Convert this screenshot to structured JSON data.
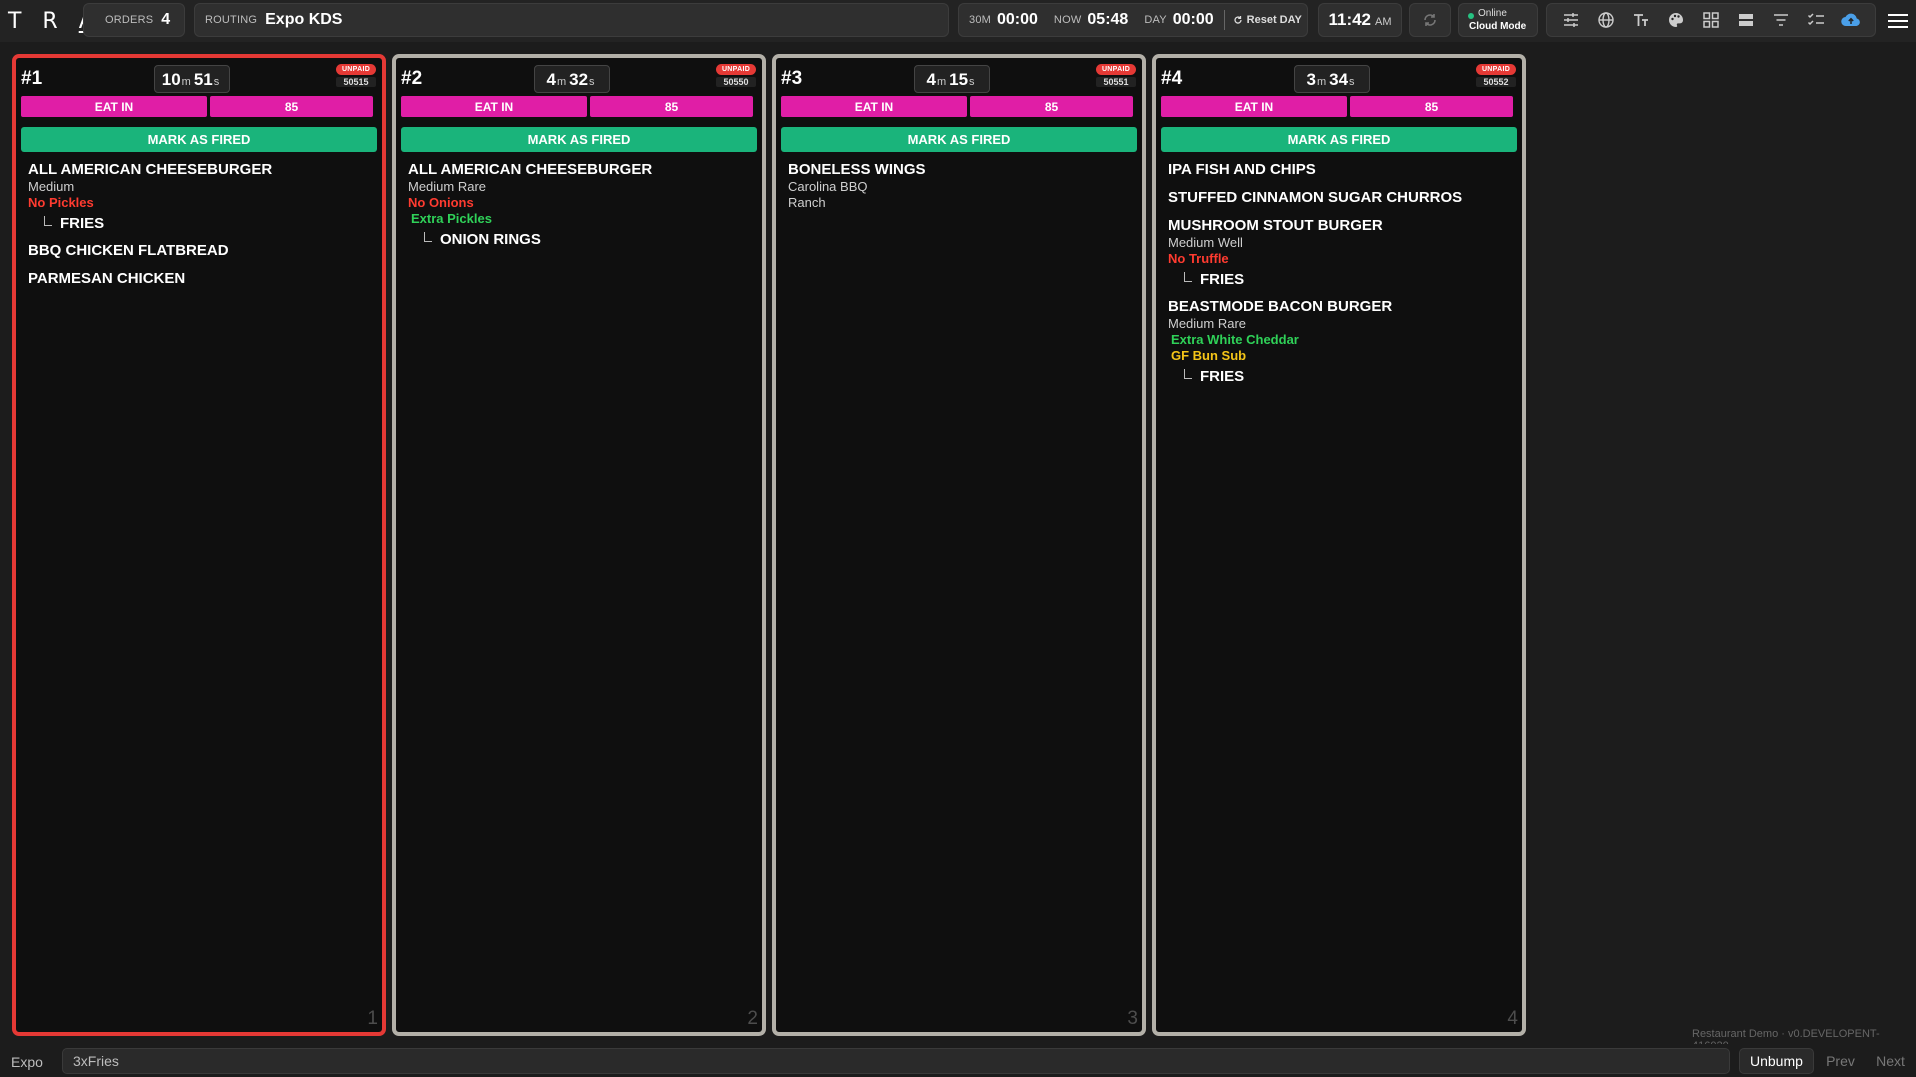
{
  "header": {
    "logo": "TRAY",
    "orders_label": "ORDERS",
    "orders_count": "4",
    "routing_label": "ROUTING",
    "routing_value": "Expo KDS",
    "t30_label": "30M",
    "t30_value": "00:00",
    "now_label": "NOW",
    "now_value": "05:48",
    "day_label": "DAY",
    "day_value": "00:00",
    "reset_label": "Reset DAY",
    "clock_time": "11:42",
    "clock_ampm": "AM",
    "status_line1": "Online",
    "status_line2": "Cloud Mode",
    "icons": [
      "refresh-icon",
      "sliders-icon",
      "globe-icon",
      "text-size-icon",
      "palette-icon",
      "grid-icon",
      "rows-icon",
      "filter-icon",
      "checklist-icon",
      "cloud-upload-icon",
      "hamburger-menu-icon"
    ],
    "colors": {
      "online_dot": "#26c281",
      "cloud": "#4a9fe8"
    }
  },
  "tickets": [
    {
      "num": "#1",
      "min": "10",
      "min_unit": "m",
      "sec": "51",
      "sec_unit": "s",
      "unpaid": "UNPAID",
      "order_id": "50515",
      "order_type": "EAT IN",
      "table": "85",
      "fired_label": "MARK AS FIRED",
      "index": "1",
      "items": [
        {
          "name": "ALL AMERICAN CHEESEBURGER",
          "mods": [
            {
              "text": "Medium",
              "style": "plain"
            },
            {
              "text": "No Pickles",
              "style": "red"
            }
          ],
          "subs": [
            "FRIES"
          ]
        },
        {
          "name": "BBQ CHICKEN FLATBREAD",
          "mods": [],
          "subs": []
        },
        {
          "name": "PARMESAN CHICKEN",
          "mods": [],
          "subs": []
        }
      ]
    },
    {
      "num": "#2",
      "min": "4",
      "min_unit": "m",
      "sec": "32",
      "sec_unit": "s",
      "unpaid": "UNPAID",
      "order_id": "50550",
      "order_type": "EAT IN",
      "table": "85",
      "fired_label": "MARK AS FIRED",
      "index": "2",
      "items": [
        {
          "name": "ALL AMERICAN CHEESEBURGER",
          "mods": [
            {
              "text": "Medium Rare",
              "style": "plain"
            },
            {
              "text": "No Onions",
              "style": "red"
            },
            {
              "text": "Extra Pickles",
              "style": "green"
            }
          ],
          "subs": [
            "ONION RINGS"
          ]
        }
      ]
    },
    {
      "num": "#3",
      "min": "4",
      "min_unit": "m",
      "sec": "15",
      "sec_unit": "s",
      "unpaid": "UNPAID",
      "order_id": "50551",
      "order_type": "EAT IN",
      "table": "85",
      "fired_label": "MARK AS FIRED",
      "index": "3",
      "items": [
        {
          "name": "BONELESS WINGS",
          "mods": [
            {
              "text": "Carolina BBQ",
              "style": "plain"
            },
            {
              "text": "Ranch",
              "style": "plain"
            }
          ],
          "subs": []
        }
      ]
    },
    {
      "num": "#4",
      "min": "3",
      "min_unit": "m",
      "sec": "34",
      "sec_unit": "s",
      "unpaid": "UNPAID",
      "order_id": "50552",
      "order_type": "EAT IN",
      "table": "85",
      "fired_label": "MARK AS FIRED",
      "index": "4",
      "items": [
        {
          "name": "IPA FISH AND CHIPS",
          "mods": [],
          "subs": []
        },
        {
          "name": "STUFFED CINNAMON SUGAR CHURROS",
          "mods": [],
          "subs": []
        },
        {
          "name": "MUSHROOM STOUT BURGER",
          "mods": [
            {
              "text": "Medium Well",
              "style": "plain"
            },
            {
              "text": "No Truffle",
              "style": "red"
            }
          ],
          "subs": [
            "FRIES"
          ]
        },
        {
          "name": "BEASTMODE BACON BURGER",
          "mods": [
            {
              "text": "Medium Rare",
              "style": "plain"
            },
            {
              "text": "Extra White Cheddar",
              "style": "green"
            },
            {
              "text": "GF Bun Sub",
              "style": "yellow"
            }
          ],
          "subs": [
            "FRIES"
          ]
        }
      ]
    }
  ],
  "footer": {
    "version": "Restaurant Demo · v0.DEVELOPENT-416020",
    "station_label": "Expo",
    "input_value": "3xFries",
    "unbump_label": "Unbump",
    "prev_label": "Prev",
    "next_label": "Next"
  }
}
